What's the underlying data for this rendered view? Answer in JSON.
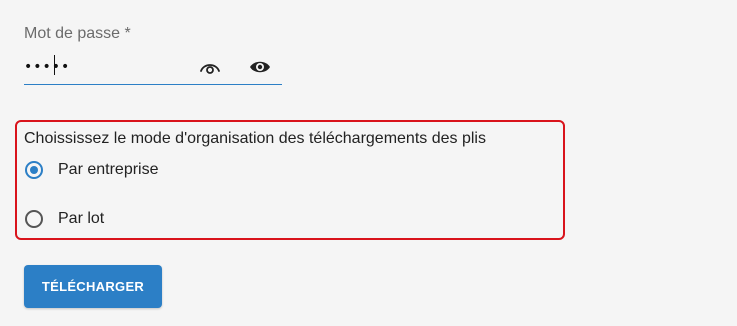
{
  "password": {
    "label": "Mot de passe",
    "required_marker": "*",
    "value": "•••••",
    "icons": [
      "eye-outline-icon",
      "eye-filled-icon"
    ]
  },
  "download_mode": {
    "title": "Choississez le mode d'organisation des téléchargements des plis",
    "options": [
      {
        "label": "Par entreprise",
        "selected": true
      },
      {
        "label": "Par lot",
        "selected": false
      }
    ],
    "highlight_color": "#d9141c"
  },
  "actions": {
    "download_label": "TÉLÉCHARGER"
  },
  "colors": {
    "accent": "#2c7fc6",
    "background": "#f5f5f5"
  }
}
